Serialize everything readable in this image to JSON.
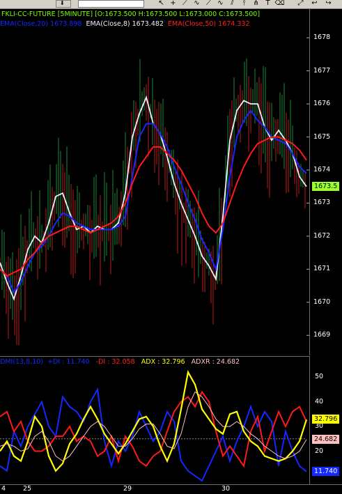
{
  "toolbar": {
    "dropdown_arrow": "⬇",
    "buttons": [
      "pointer-icon",
      "crosshair-icon",
      "line-icon",
      "trend-icon",
      "ray-icon",
      "polyline-icon",
      "channel-icon",
      "hline-icon",
      "fib-icon",
      "text-icon",
      "eraser-icon",
      "expand-icon",
      "back-icon",
      "forward-icon"
    ]
  },
  "price_panel": {
    "header": {
      "symbol": "FKLI-CC-FUTURE [5MINUTE]",
      "ohlc": "[O:1673.500 H:1673.500 L:1673.000 C:1673.500]",
      "ema20_label": "EMA(Close,20)",
      "ema20_value": "1673.898",
      "ema8_label": "EMA(Close,8)",
      "ema8_value": "1673.482",
      "ema50_label": "EMA(Close,50)",
      "ema50_value": "1674.332"
    },
    "y_ticks": [
      "1678",
      "1677",
      "1676",
      "1675",
      "1674",
      "1673",
      "1672",
      "1671",
      "1670",
      "1669"
    ],
    "last_price": "1673.5"
  },
  "dmi_panel": {
    "header": {
      "title": "DMI(13,8,10)",
      "plus_di": "+DI : 11.740",
      "minus_di": "-DI : 32.058",
      "adx": "ADX : 32.796",
      "adxr": "ADXR : 24.682"
    },
    "y_ticks": [
      "50",
      "40",
      "30",
      "20"
    ],
    "badges": {
      "adx": "32.796",
      "adxr": "24.682",
      "plus_di": "11.740"
    }
  },
  "x_axis": {
    "labels": [
      "4",
      "25",
      "29",
      "30"
    ]
  },
  "chart_data": [
    {
      "type": "line",
      "title": "FKLI-CC-FUTURE [5MINUTE]",
      "ylim": [
        1668.5,
        1678.3
      ],
      "colors": {
        "ema8": "#e8f4ff",
        "ema20": "#1428ff",
        "ema50": "#ff1a1a",
        "bull_bar": "#22aa44",
        "bear_bar": "#ee2222"
      },
      "x": [
        0,
        10,
        20,
        30,
        40,
        50,
        60,
        70,
        80,
        90,
        100,
        110,
        120,
        130,
        140,
        150,
        160,
        170,
        180,
        190,
        200,
        210,
        220,
        230,
        240,
        250,
        260,
        270,
        280,
        290,
        300,
        310,
        320,
        330,
        340,
        350,
        360,
        370,
        380,
        390,
        400,
        410,
        420,
        430,
        440
      ],
      "series": [
        {
          "name": "EMA(Close,8)",
          "values": [
            1671.2,
            1670.6,
            1670.1,
            1670.8,
            1671.6,
            1672.0,
            1671.8,
            1672.4,
            1673.2,
            1673.3,
            1672.7,
            1672.2,
            1672.3,
            1672.1,
            1672.3,
            1672.2,
            1672.2,
            1672.4,
            1673.3,
            1675.0,
            1675.7,
            1676.2,
            1675.4,
            1675.1,
            1674.4,
            1673.6,
            1673.0,
            1672.5,
            1672.0,
            1671.4,
            1671.1,
            1670.7,
            1672.6,
            1674.9,
            1675.8,
            1676.1,
            1676.0,
            1676.0,
            1675.3,
            1674.9,
            1675.2,
            1674.9,
            1674.5,
            1673.8,
            1673.5
          ]
        },
        {
          "name": "EMA(Close,20)",
          "values": [
            1671.0,
            1670.8,
            1670.3,
            1670.6,
            1671.1,
            1671.5,
            1671.7,
            1672.0,
            1672.4,
            1672.7,
            1672.6,
            1672.4,
            1672.3,
            1672.2,
            1672.2,
            1672.2,
            1672.2,
            1672.3,
            1672.6,
            1673.8,
            1675.0,
            1675.4,
            1675.4,
            1675.1,
            1674.7,
            1674.1,
            1673.6,
            1673.0,
            1672.5,
            1671.9,
            1671.5,
            1671.0,
            1672.2,
            1673.8,
            1675.0,
            1675.5,
            1675.8,
            1675.5,
            1675.3,
            1675.0,
            1674.9,
            1674.8,
            1674.5,
            1674.1,
            1673.9
          ]
        },
        {
          "name": "EMA(Close,50)",
          "values": [
            1671.0,
            1670.8,
            1670.9,
            1671.0,
            1671.3,
            1671.5,
            1671.8,
            1672.0,
            1672.1,
            1672.2,
            1672.3,
            1672.3,
            1672.2,
            1672.1,
            1672.2,
            1672.3,
            1672.4,
            1672.6,
            1673.0,
            1673.6,
            1674.1,
            1674.4,
            1674.7,
            1674.7,
            1674.5,
            1674.3,
            1674.0,
            1673.6,
            1673.2,
            1672.7,
            1672.3,
            1672.1,
            1672.4,
            1673.0,
            1673.6,
            1674.1,
            1674.5,
            1674.8,
            1674.9,
            1675.0,
            1675.0,
            1674.9,
            1674.8,
            1674.6,
            1674.3
          ]
        }
      ]
    },
    {
      "type": "line",
      "title": "DMI(13,8,10)",
      "ylim": [
        8,
        56
      ],
      "colors": {
        "plus_di": "#1428ff",
        "minus_di": "#ff1a1a",
        "adx": "#ffff00",
        "adxr": "#ffc0c0"
      },
      "x": [
        0,
        10,
        20,
        30,
        40,
        50,
        60,
        70,
        80,
        90,
        100,
        110,
        120,
        130,
        140,
        150,
        160,
        170,
        180,
        190,
        200,
        210,
        220,
        230,
        240,
        250,
        260,
        270,
        280,
        290,
        300,
        310,
        320,
        330,
        340,
        350,
        360,
        370,
        380,
        390,
        400,
        410,
        420,
        430,
        440
      ],
      "series": [
        {
          "name": "+DI",
          "values": [
            14,
            12,
            28,
            22,
            30,
            35,
            40,
            30,
            26,
            42,
            38,
            36,
            32,
            40,
            45,
            24,
            14,
            24,
            20,
            26,
            36,
            30,
            24,
            28,
            36,
            32,
            16,
            12,
            10,
            8,
            14,
            20,
            26,
            16,
            24,
            30,
            38,
            30,
            36,
            32,
            14,
            28,
            20,
            14,
            11.7
          ]
        },
        {
          "name": "-DI",
          "values": [
            34,
            36,
            28,
            32,
            24,
            20,
            20,
            22,
            26,
            26,
            30,
            24,
            26,
            24,
            18,
            20,
            26,
            16,
            26,
            22,
            16,
            14,
            18,
            20,
            28,
            36,
            40,
            42,
            38,
            44,
            40,
            28,
            18,
            22,
            18,
            14,
            28,
            34,
            20,
            28,
            36,
            30,
            36,
            38,
            32.1
          ]
        },
        {
          "name": "ADX",
          "values": [
            20,
            24,
            18,
            16,
            24,
            34,
            30,
            18,
            12,
            15,
            23,
            27,
            33,
            38,
            33,
            27,
            23,
            19,
            23,
            28,
            33,
            34,
            30,
            22,
            16,
            23,
            37,
            52,
            47,
            37,
            33,
            29,
            27,
            35,
            36,
            28,
            24,
            22,
            18,
            17,
            16,
            17,
            20,
            24,
            32.8
          ]
        },
        {
          "name": "ADXR",
          "values": [
            22,
            23,
            22,
            20,
            21,
            26,
            28,
            24,
            18,
            16,
            18,
            22,
            26,
            30,
            32,
            30,
            26,
            22,
            22,
            25,
            29,
            31,
            31,
            27,
            22,
            21,
            27,
            38,
            44,
            42,
            38,
            33,
            30,
            30,
            32,
            30,
            27,
            25,
            22,
            20,
            18,
            17,
            18,
            20,
            24.7
          ]
        }
      ]
    }
  ]
}
